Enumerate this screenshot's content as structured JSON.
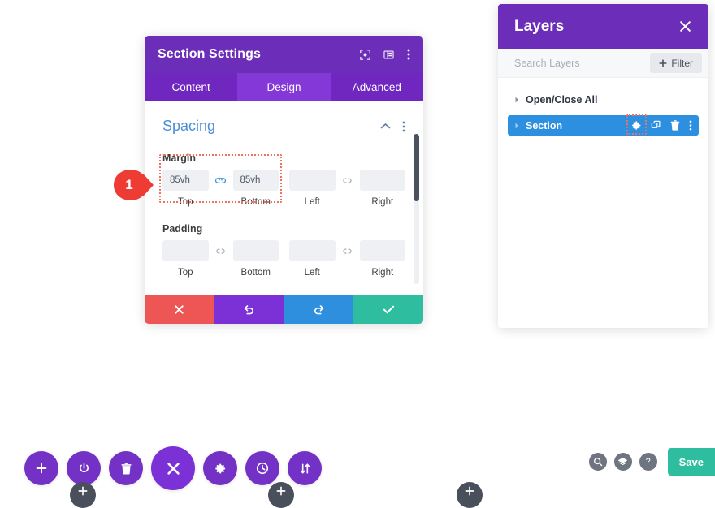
{
  "settings_modal": {
    "title": "Section Settings",
    "header_icons": [
      {
        "name": "focus-icon",
        "label": "Focus"
      },
      {
        "name": "layout-panel-icon",
        "label": "Layout"
      },
      {
        "name": "more-options-icon",
        "label": "More"
      }
    ],
    "tabs": [
      {
        "label": "Content",
        "active": false
      },
      {
        "label": "Design",
        "active": true
      },
      {
        "label": "Advanced",
        "active": false
      }
    ],
    "group": {
      "title": "Spacing",
      "collapse_icon": "chevron-up-icon",
      "menu_icon": "more-options-icon"
    },
    "margin": {
      "label": "Margin",
      "top": {
        "value": "85vh",
        "sublabel": "Top"
      },
      "bottom": {
        "value": "85vh",
        "sublabel": "Bottom"
      },
      "left": {
        "value": "",
        "sublabel": "Left"
      },
      "right": {
        "value": "",
        "sublabel": "Right"
      },
      "link_tb_state": "linked",
      "link_lr_state": "unlinked"
    },
    "padding": {
      "label": "Padding",
      "top": {
        "value": "",
        "sublabel": "Top"
      },
      "bottom": {
        "value": "",
        "sublabel": "Bottom"
      },
      "left": {
        "value": "",
        "sublabel": "Left"
      },
      "right": {
        "value": "",
        "sublabel": "Right"
      },
      "link_tb_state": "unlinked",
      "link_lr_state": "unlinked"
    },
    "footer": [
      {
        "name": "cancel-button",
        "icon": "close-icon",
        "color": "#EE5656"
      },
      {
        "name": "undo-button",
        "icon": "undo-icon",
        "color": "#7B31D6"
      },
      {
        "name": "redo-button",
        "icon": "redo-icon",
        "color": "#2E8FDE"
      },
      {
        "name": "save-button",
        "icon": "check-icon",
        "color": "#2EBE9F"
      }
    ]
  },
  "pin_marker": {
    "number": "1",
    "color": "#EE3B33"
  },
  "layers_panel": {
    "title": "Layers",
    "close_icon": "close-icon",
    "search_placeholder": "Search Layers",
    "search_value": "",
    "filter_label": "Filter",
    "rows": [
      {
        "name": "Open/Close All",
        "selected": false,
        "actions": []
      },
      {
        "name": "Section",
        "selected": true,
        "actions": [
          {
            "name": "settings-gear-icon",
            "highlighted": true
          },
          {
            "name": "duplicate-icon",
            "highlighted": false
          },
          {
            "name": "delete-icon",
            "highlighted": false
          },
          {
            "name": "more-options-icon",
            "highlighted": false
          }
        ]
      }
    ]
  },
  "bottom_toolbar": {
    "buttons": [
      {
        "name": "add-icon",
        "large": false
      },
      {
        "name": "power-icon",
        "large": false
      },
      {
        "name": "trash-icon",
        "large": false
      },
      {
        "name": "close-icon",
        "large": true
      },
      {
        "name": "settings-gear-icon",
        "large": false
      },
      {
        "name": "history-clock-icon",
        "large": false
      },
      {
        "name": "sort-arrows-icon",
        "large": false
      }
    ]
  },
  "bottom_right": {
    "circles": [
      {
        "name": "zoom-search-icon",
        "glyph": "search"
      },
      {
        "name": "layers-stack-icon",
        "glyph": "layers"
      },
      {
        "name": "help-icon",
        "glyph": "?"
      }
    ],
    "save_label": "Save"
  },
  "colors": {
    "purple_header": "#6C2EB9",
    "purple_tab_active": "#8438D8",
    "blue_accent": "#4C8FD4",
    "blue_selected_row": "#2D8FE0",
    "teal_save": "#2EBE9F",
    "red_cancel": "#EE5656",
    "highlight_dotted": "#F0715E",
    "input_bg": "#EEF0F4"
  }
}
